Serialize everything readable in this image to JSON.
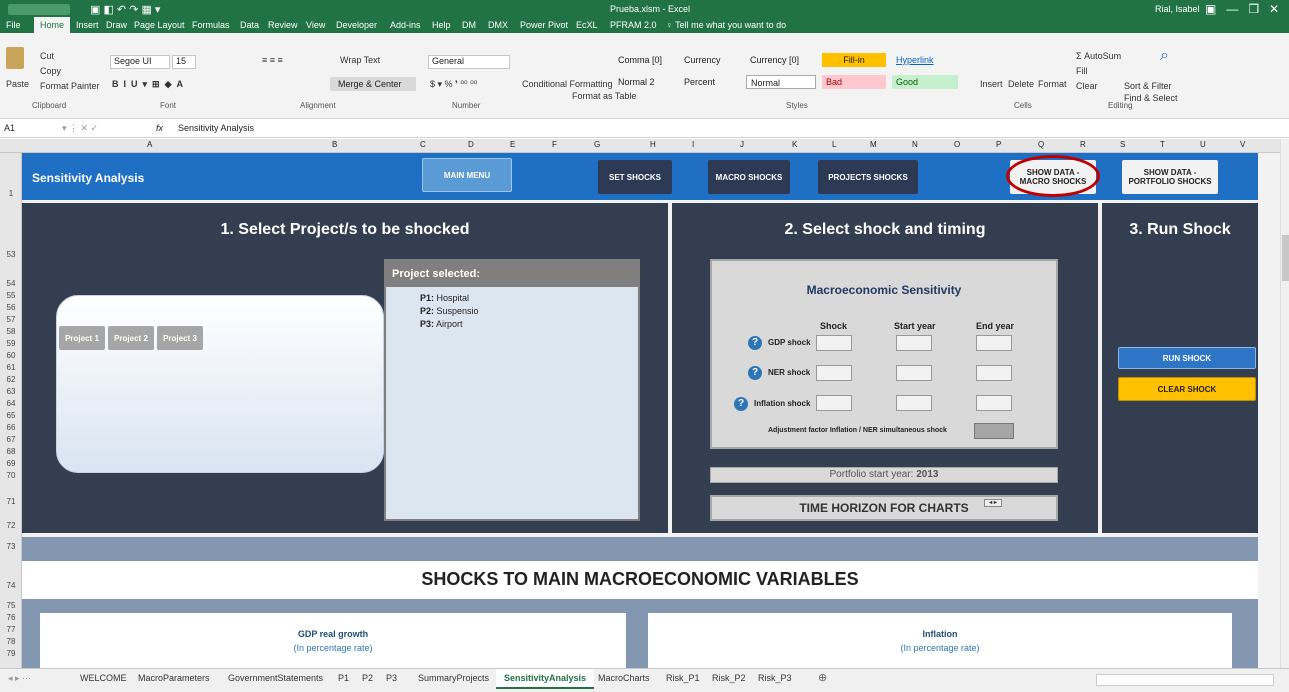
{
  "titlebar": {
    "filename": "Prueba.xlsm  -  Excel",
    "user": "Rial, Isabel"
  },
  "menu": [
    "File",
    "Home",
    "Insert",
    "Draw",
    "Page Layout",
    "Formulas",
    "Data",
    "Review",
    "View",
    "Developer",
    "Add-ins",
    "Help",
    "DM",
    "DMX",
    "Power Pivot",
    "EcXL",
    "PFRAM 2.0"
  ],
  "tellme": "Tell me what you want to do",
  "clipboard": {
    "cut": "Cut",
    "copy": "Copy",
    "paste": "Paste",
    "painter": "Format Painter",
    "label": "Clipboard"
  },
  "font": {
    "name": "Segoe UI",
    "size": "15",
    "label": "Font"
  },
  "alignment": {
    "wrap": "Wrap Text",
    "merge": "Merge & Center",
    "label": "Alignment"
  },
  "number": {
    "format": "General",
    "label": "Number"
  },
  "styles": {
    "cond": "Conditional Formatting",
    "fmt": "Format as Table",
    "label": "Styles",
    "cells": [
      "Comma [0]",
      "Currency",
      "Currency [0]",
      "Fill-in",
      "Hyperlink",
      "Normal 2",
      "Percent",
      "Normal",
      "Bad",
      "Good"
    ]
  },
  "cells_grp": {
    "insert": "Insert",
    "delete": "Delete",
    "format": "Format",
    "label": "Cells"
  },
  "editing": {
    "autosum": "AutoSum",
    "fill": "Fill",
    "clear": "Clear",
    "sort": "Sort & Filter",
    "find": "Find & Select",
    "label": "Editing"
  },
  "formulabar": {
    "namebox": "A1",
    "fx": "fx",
    "content": "Sensitivity Analysis"
  },
  "columns": [
    "A",
    "B",
    "C",
    "D",
    "E",
    "F",
    "G",
    "H",
    "I",
    "J",
    "K",
    "L",
    "M",
    "N",
    "O",
    "P",
    "Q",
    "R",
    "S",
    "T",
    "U",
    "V"
  ],
  "rows": [
    "1",
    "53",
    "54",
    "55",
    "56",
    "57",
    "58",
    "59",
    "60",
    "61",
    "62",
    "63",
    "64",
    "65",
    "66",
    "67",
    "68",
    "69",
    "70",
    "71",
    "72",
    "73",
    "74",
    "75",
    "76",
    "77",
    "78",
    "79"
  ],
  "header": {
    "title": "Sensitivity Analysis",
    "main_menu": "MAIN MENU",
    "set_shocks": "SET SHOCKS",
    "macro_shocks": "MACRO SHOCKS",
    "projects_shocks": "PROJECTS SHOCKS",
    "show_macro_1": "SHOW DATA -",
    "show_macro_2": "MACRO SHOCKS",
    "show_port_1": "SHOW DATA -",
    "show_port_2": "PORTFOLIO SHOCKS"
  },
  "section1": {
    "title": "1. Select Project/s to be shocked",
    "projects": [
      "Project 1",
      "Project 2",
      "Project 3"
    ],
    "selected_title": "Project selected:",
    "selected": [
      {
        "k": "P1:",
        "v": "Hospital"
      },
      {
        "k": "P2:",
        "v": "Suspensio"
      },
      {
        "k": "P3:",
        "v": "Airport"
      }
    ]
  },
  "section2": {
    "title": "2. Select shock and timing",
    "box_title": "Macroeconomic Sensitivity",
    "col_shock": "Shock",
    "col_start": "Start year",
    "col_end": "End year",
    "rows": [
      "GDP shock",
      "NER shock",
      "Inflation shock"
    ],
    "adjust": "Adjustment factor Inflation / NER simultaneous shock",
    "portfolio_label": "Portfolio start year:",
    "portfolio_year": "2013",
    "horizon": "TIME HORIZON FOR CHARTS"
  },
  "section3": {
    "title": "3. Run Shock",
    "run": "RUN SHOCK",
    "clear": "CLEAR SHOCK"
  },
  "bottom": {
    "title": "SHOCKS TO MAIN MACROECONOMIC VARIABLES",
    "chart1_title": "GDP real growth",
    "chart1_sub": "(In percentage rate)",
    "chart2_title": "Inflation",
    "chart2_sub": "(In percentage rate)"
  },
  "sheettabs": [
    "WELCOME",
    "MacroParameters",
    "GovernmentStatements",
    "P1",
    "P2",
    "P3",
    "SummaryProjects",
    "SensitivityAnalysis",
    "MacroCharts",
    "Risk_P1",
    "Risk_P2",
    "Risk_P3"
  ],
  "active_tab": "SensitivityAnalysis"
}
